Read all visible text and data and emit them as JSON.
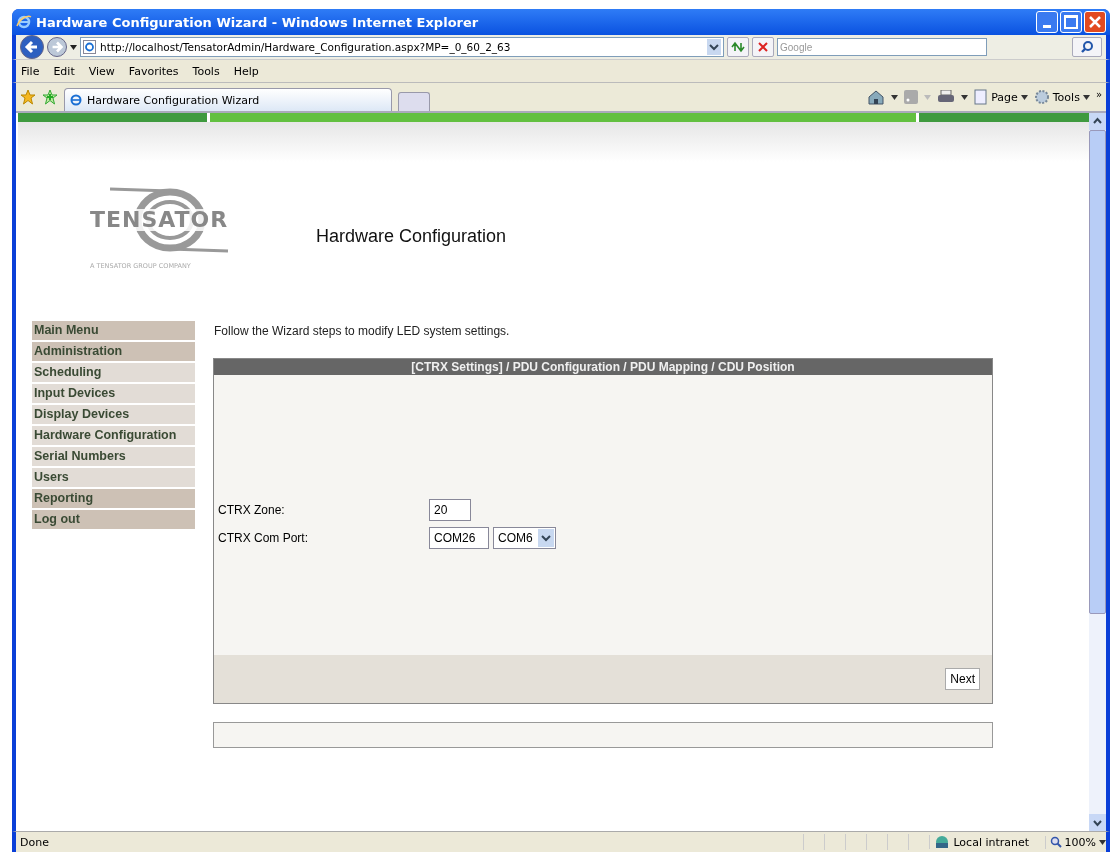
{
  "window": {
    "title": "Hardware Configuration Wizard - Windows Internet Explorer"
  },
  "address_bar": {
    "url": "http://localhost/TensatorAdmin/Hardware_Configuration.aspx?MP=_0_60_2_63"
  },
  "search": {
    "placeholder": "Google"
  },
  "menu_bar": [
    "File",
    "Edit",
    "View",
    "Favorites",
    "Tools",
    "Help"
  ],
  "tabs": [
    {
      "label": "Hardware Configuration Wizard",
      "selected": true
    }
  ],
  "command_bar": {
    "page": "Page",
    "tools": "Tools",
    "more": "»"
  },
  "page": {
    "logo_text": "TENSATOR",
    "logo_tagline": "A TENSATOR GROUP COMPANY",
    "heading": "Hardware Configuration",
    "sidebar": {
      "items": [
        {
          "label": "Main Menu",
          "highlighted": true
        },
        {
          "label": "Administration",
          "highlighted": true
        },
        {
          "label": "Scheduling",
          "highlighted": false
        },
        {
          "label": "Input Devices",
          "highlighted": false
        },
        {
          "label": "Display Devices",
          "highlighted": false
        },
        {
          "label": "Hardware Configuration",
          "highlighted": false
        },
        {
          "label": "Serial Numbers",
          "highlighted": false
        },
        {
          "label": "Users",
          "highlighted": false
        },
        {
          "label": "Reporting",
          "highlighted": true
        },
        {
          "label": "Log out",
          "highlighted": true
        }
      ]
    },
    "instruction": "Follow the Wizard steps to modify LED system settings.",
    "wizard": {
      "steps_header": "[CTRX Settings] / PDU Configuration / PDU Mapping / CDU Position",
      "fields": [
        {
          "label": "CTRX Zone:",
          "value": "20"
        },
        {
          "label": "CTRX Com Port:",
          "value": "COM26",
          "select": "COM6"
        }
      ],
      "next_button": "Next"
    }
  },
  "status_bar": {
    "status": "Done",
    "zone": "Local intranet",
    "zoom": "100%"
  }
}
